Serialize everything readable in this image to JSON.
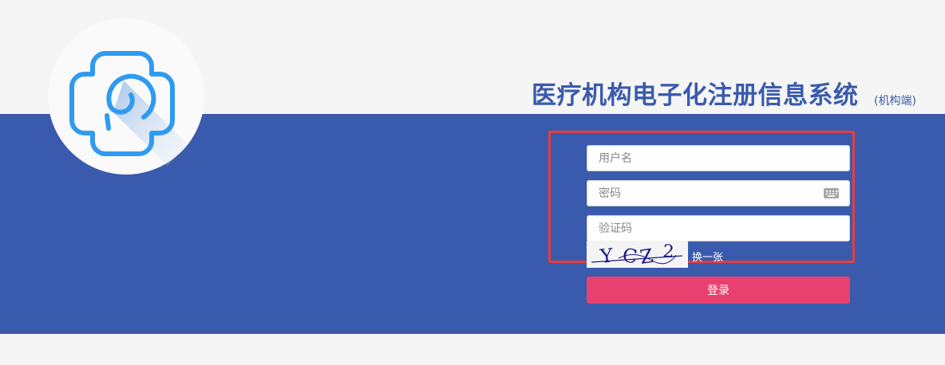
{
  "header": {
    "title": "医疗机构电子化注册信息系统",
    "subtitle": "(机构端)"
  },
  "logo": {
    "icon": "medical-cross-logo-icon"
  },
  "form": {
    "username_placeholder": "用户名",
    "password_placeholder": "密码",
    "captcha_placeholder": "验证码",
    "captcha_text": "YCZ2",
    "refresh_label": "换一张",
    "login_label": "登录",
    "keyboard_icon": "keyboard-icon"
  },
  "colors": {
    "band": "#3a5bad",
    "title": "#3a5bad",
    "login_button": "#e8416f",
    "highlight_box": "#e53e3e",
    "logo_stroke": "#2f9bf0"
  }
}
